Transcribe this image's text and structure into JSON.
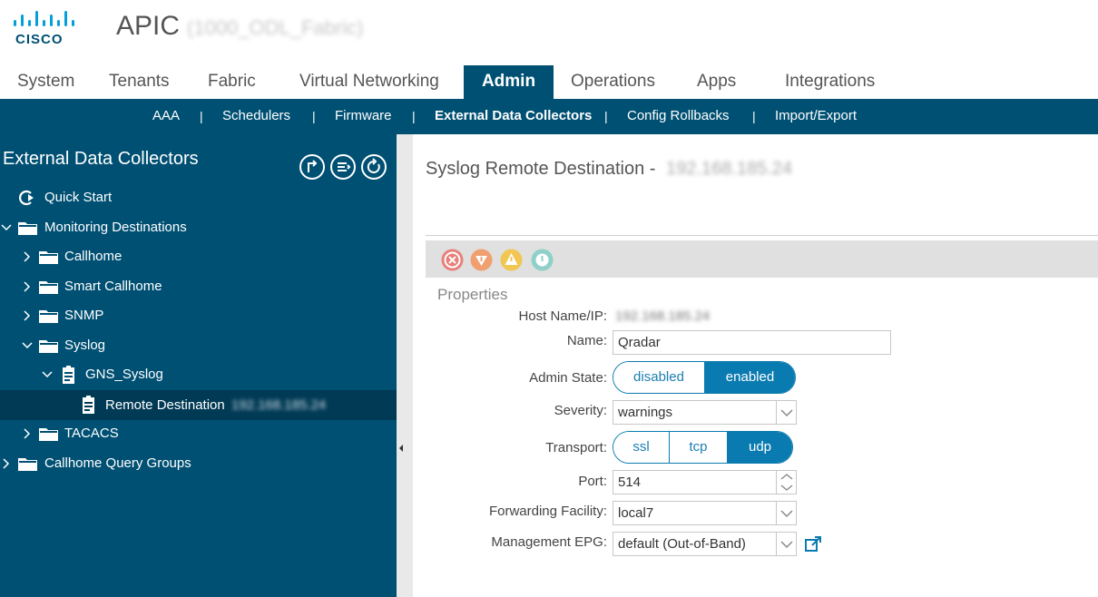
{
  "header": {
    "app_title": "APIC",
    "fabric_name": "(1000_ODL_Fabric)"
  },
  "tabs": [
    {
      "label": "System"
    },
    {
      "label": "Tenants"
    },
    {
      "label": "Fabric"
    },
    {
      "label": "Virtual Networking"
    },
    {
      "label": "Admin"
    },
    {
      "label": "Operations"
    },
    {
      "label": "Apps"
    },
    {
      "label": "Integrations"
    }
  ],
  "subnav": [
    {
      "label": "AAA"
    },
    {
      "label": "Schedulers"
    },
    {
      "label": "Firmware"
    },
    {
      "label": "External Data Collectors"
    },
    {
      "label": "Config Rollbacks"
    },
    {
      "label": "Import/Export"
    }
  ],
  "subnav_separator": "|",
  "sidebar": {
    "title": "External Data Collectors",
    "tree": [
      {
        "label": "Quick Start"
      },
      {
        "label": "Monitoring Destinations"
      },
      {
        "label": "Callhome"
      },
      {
        "label": "Smart Callhome"
      },
      {
        "label": "SNMP"
      },
      {
        "label": "Syslog"
      },
      {
        "label": "GNS_Syslog"
      },
      {
        "label": "Remote Destination",
        "suffix": "192.168.185.24"
      },
      {
        "label": "TACACS"
      },
      {
        "label": "Callhome Query Groups"
      }
    ]
  },
  "content": {
    "title": "Syslog Remote Destination -",
    "title_suffix": "192.168.185.24",
    "section": "Properties",
    "fields": {
      "host_label": "Host Name/IP:",
      "host_value": "192.168.185.24",
      "name_label": "Name:",
      "name_value": "Qradar",
      "admin_state_label": "Admin State:",
      "admin_state_options": [
        "disabled",
        "enabled"
      ],
      "admin_state_selected": "enabled",
      "severity_label": "Severity:",
      "severity_value": "warnings",
      "transport_label": "Transport:",
      "transport_options": [
        "ssl",
        "tcp",
        "udp"
      ],
      "transport_selected": "udp",
      "port_label": "Port:",
      "port_value": "514",
      "facility_label": "Forwarding Facility:",
      "facility_value": "local7",
      "epg_label": "Management EPG:",
      "epg_value": "default (Out-of-Band)"
    }
  },
  "colors": {
    "brand_dark": "#005073",
    "accent": "#0a7bb0",
    "fault_critical": "#e8807a",
    "fault_major": "#f0a070",
    "fault_minor": "#f2c652",
    "fault_warning": "#8fd0c8"
  }
}
